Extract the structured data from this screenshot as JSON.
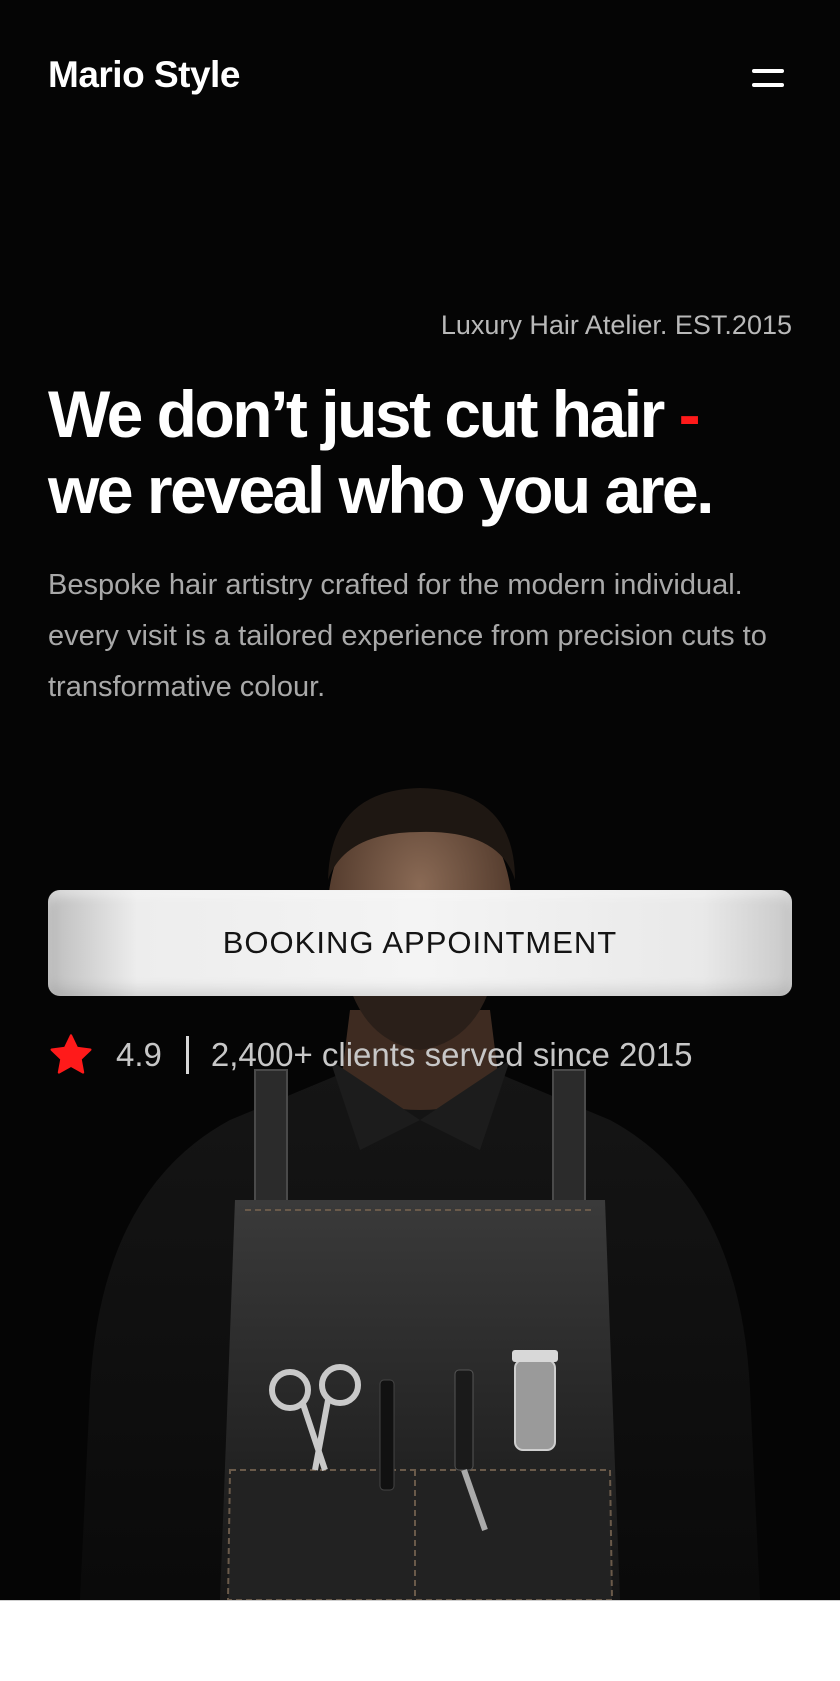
{
  "header": {
    "brand": "Mario Style",
    "menu_icon": "hamburger-menu-icon"
  },
  "hero": {
    "tagline": "Luxury Hair Atelier. EST.2015",
    "headline_line1": "We don’t just cut hair",
    "headline_dash": "-",
    "headline_line2": "we reveal who you are.",
    "description": "Bespoke hair artistry crafted for the modern individual. every visit is a tailored experience from precision cuts to transformative colour.",
    "cta_label": "BOOKING APPOINTMENT",
    "rating_icon": "star-icon",
    "rating_value": "4.9",
    "rating_caption": "2,400+ clients served since 2015"
  },
  "colors": {
    "background": "#050505",
    "accent": "#ff1a1a",
    "text_primary": "#ffffff",
    "text_muted": "#a9a9a9"
  }
}
